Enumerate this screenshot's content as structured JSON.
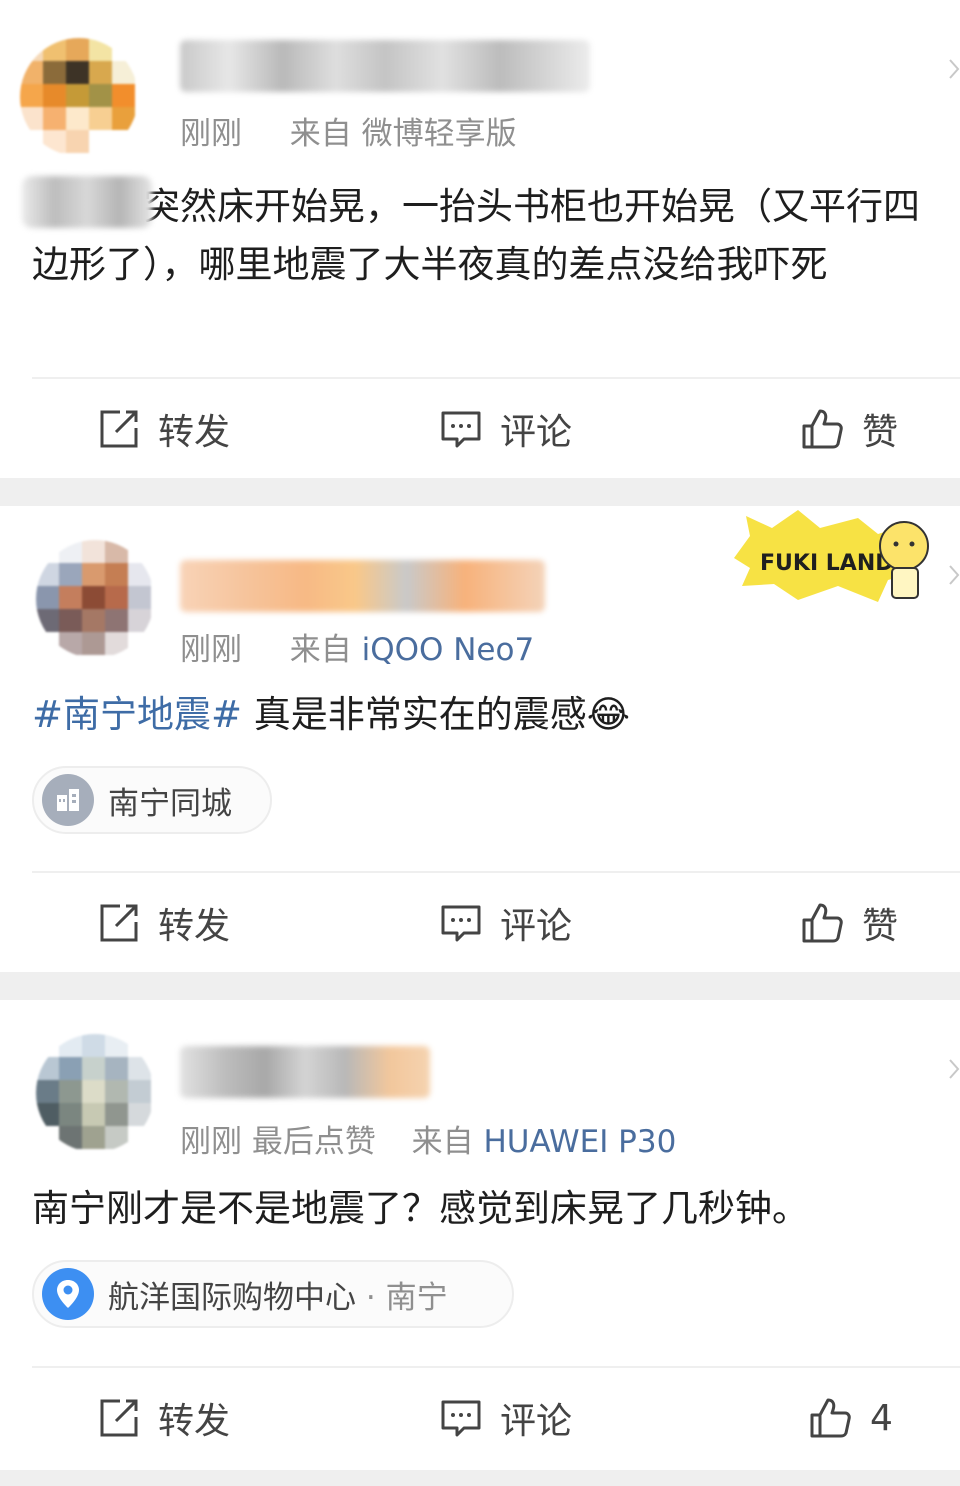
{
  "posts": [
    {
      "meta_time": "刚刚",
      "meta_source_prefix": "来自",
      "meta_source": "微博轻享版",
      "text_prefix": "",
      "text": "吃着瓜突然床开始晃，一抬头书柜也开始晃（又平行四边形了），哪里地震了大半夜真的差点没给我吓死",
      "actions": {
        "repost": "转发",
        "comment": "评论",
        "like": "赞"
      }
    },
    {
      "meta_time": "刚刚",
      "meta_source_prefix": "来自",
      "meta_source": "iQOO Neo7",
      "topic": "#南宁地震#",
      "text": " 真是非常实在的震感😂",
      "chip": "南宁同城",
      "badge_text": "FUKI LAND",
      "actions": {
        "repost": "转发",
        "comment": "评论",
        "like": "赞"
      }
    },
    {
      "meta_time": "刚刚",
      "meta_extra": "最后点赞",
      "meta_source_prefix": "来自",
      "meta_source": "HUAWEI P30",
      "text": "南宁刚才是不是地震了？感觉到床晃了几秒钟。",
      "chip": "航洋国际购物中心",
      "chip_sub": "· 南宁",
      "actions": {
        "repost": "转发",
        "comment": "评论",
        "like": "4"
      }
    }
  ],
  "colors": {
    "separator": "#efefef",
    "meta": "#8f8f8f",
    "link": "#3e6ca6",
    "location_icon": "#3d8ff2"
  },
  "icons": [
    "repost-icon",
    "comment-icon",
    "like-icon",
    "chevron-down-icon",
    "city-icon",
    "location-pin-icon"
  ]
}
